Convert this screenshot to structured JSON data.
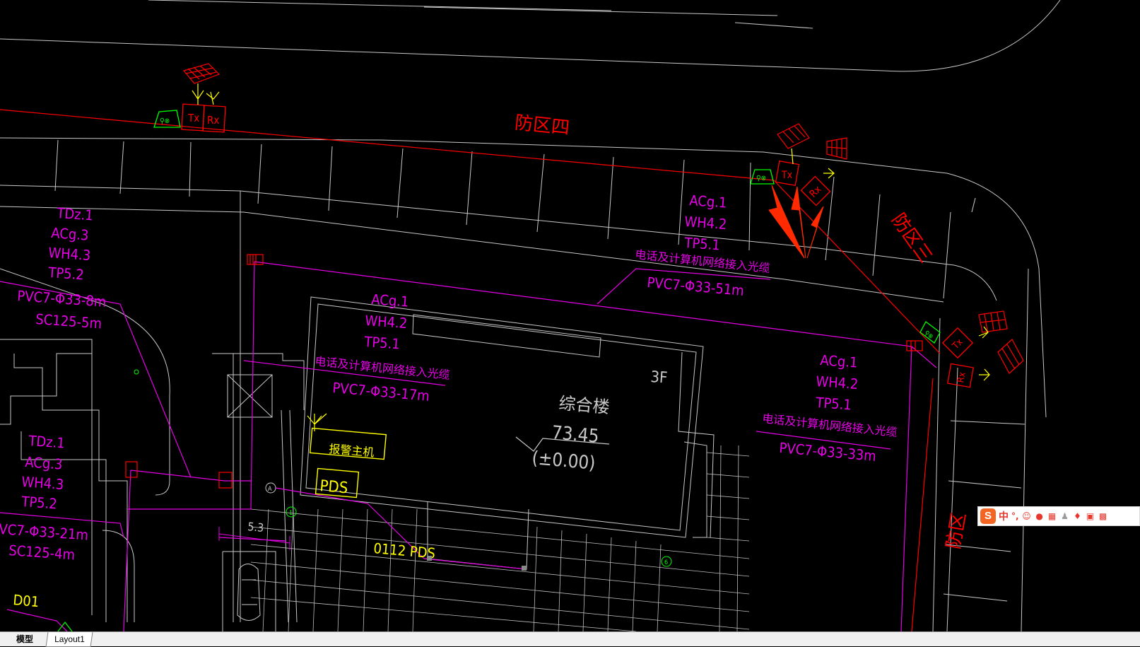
{
  "drawing": {
    "zone_labels": {
      "zone4": "防区四",
      "zone3": "防区三",
      "zone2_partial": "防区"
    },
    "device_labels": {
      "tx": "Tx",
      "rx": "Rx"
    },
    "cable_blocks": [
      {
        "lines": [
          "TDz.1",
          "ACg.3",
          "WH4.3",
          "TP5.2",
          "PVC7-Φ33-8m",
          "SC125-5m"
        ]
      },
      {
        "lines": [
          "ACg.1",
          "WH4.2",
          "TP5.1",
          "电话及计算机网络接入光缆",
          "PVC7-Φ33-17m"
        ]
      },
      {
        "lines": [
          "ACg.1",
          "WH4.2",
          "TP5.1",
          "电话及计算机网络接入光缆",
          "PVC7-Φ33-51m"
        ]
      },
      {
        "lines": [
          "ACg.1",
          "WH4.2",
          "TP5.1",
          "电话及计算机网络接入光缆",
          "PVC7-Φ33-33m"
        ]
      },
      {
        "lines": [
          "TDz.1",
          "ACg.3",
          "WH4.3",
          "TP5.2",
          "VC7-Φ33-21m",
          "SC125-4m"
        ]
      }
    ],
    "building": {
      "floors": "3F",
      "name": "综合楼",
      "elevation": "73.45",
      "relative_elevation": "(±0.00)"
    },
    "equipment": {
      "alarm_host": "报警主机",
      "pds": "PDS",
      "pds_label": "0112 PDS",
      "d01": "D01"
    },
    "dimension": "5.3",
    "grid_bubbles": [
      "A",
      "1",
      "6"
    ],
    "colors": {
      "background": "#000000",
      "cable": "#e600e6",
      "fence": "#ff0000",
      "device": "#ff0000",
      "sensor": "#00ff00",
      "equipment": "#ffff00",
      "linework": "#c8c8c8",
      "annotation_arrow": "#ff2a00"
    }
  },
  "tabs": {
    "model": "模型",
    "layout1": "Layout1"
  },
  "ime_toolbar": {
    "logo": "S",
    "mode": "中",
    "punct": "°,",
    "icons": [
      "emoji-icon",
      "microphone-icon",
      "keyboard-icon",
      "user-icon",
      "skin-icon",
      "toolbox-icon",
      "grid-icon"
    ]
  }
}
